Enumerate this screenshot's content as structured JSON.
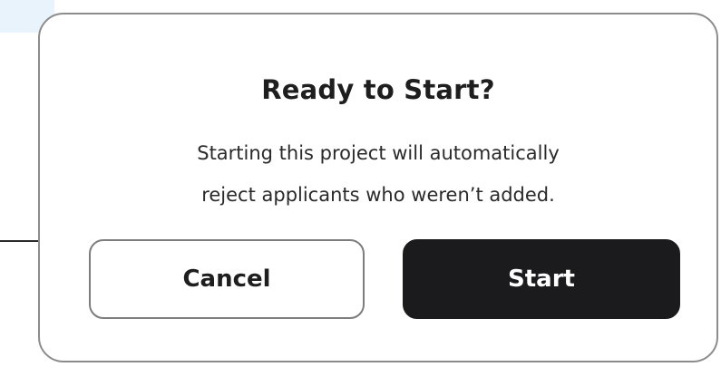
{
  "dialog": {
    "title": "Ready to Start?",
    "message_lines": [
      "Starting this project will automatically",
      "reject applicants who weren’t added."
    ],
    "cancel_label": "Cancel",
    "start_label": "Start"
  },
  "colors": {
    "primary_button": "#1b1b1d",
    "dialog_border": "#8c8c8c",
    "text": "#1e1e1e"
  }
}
